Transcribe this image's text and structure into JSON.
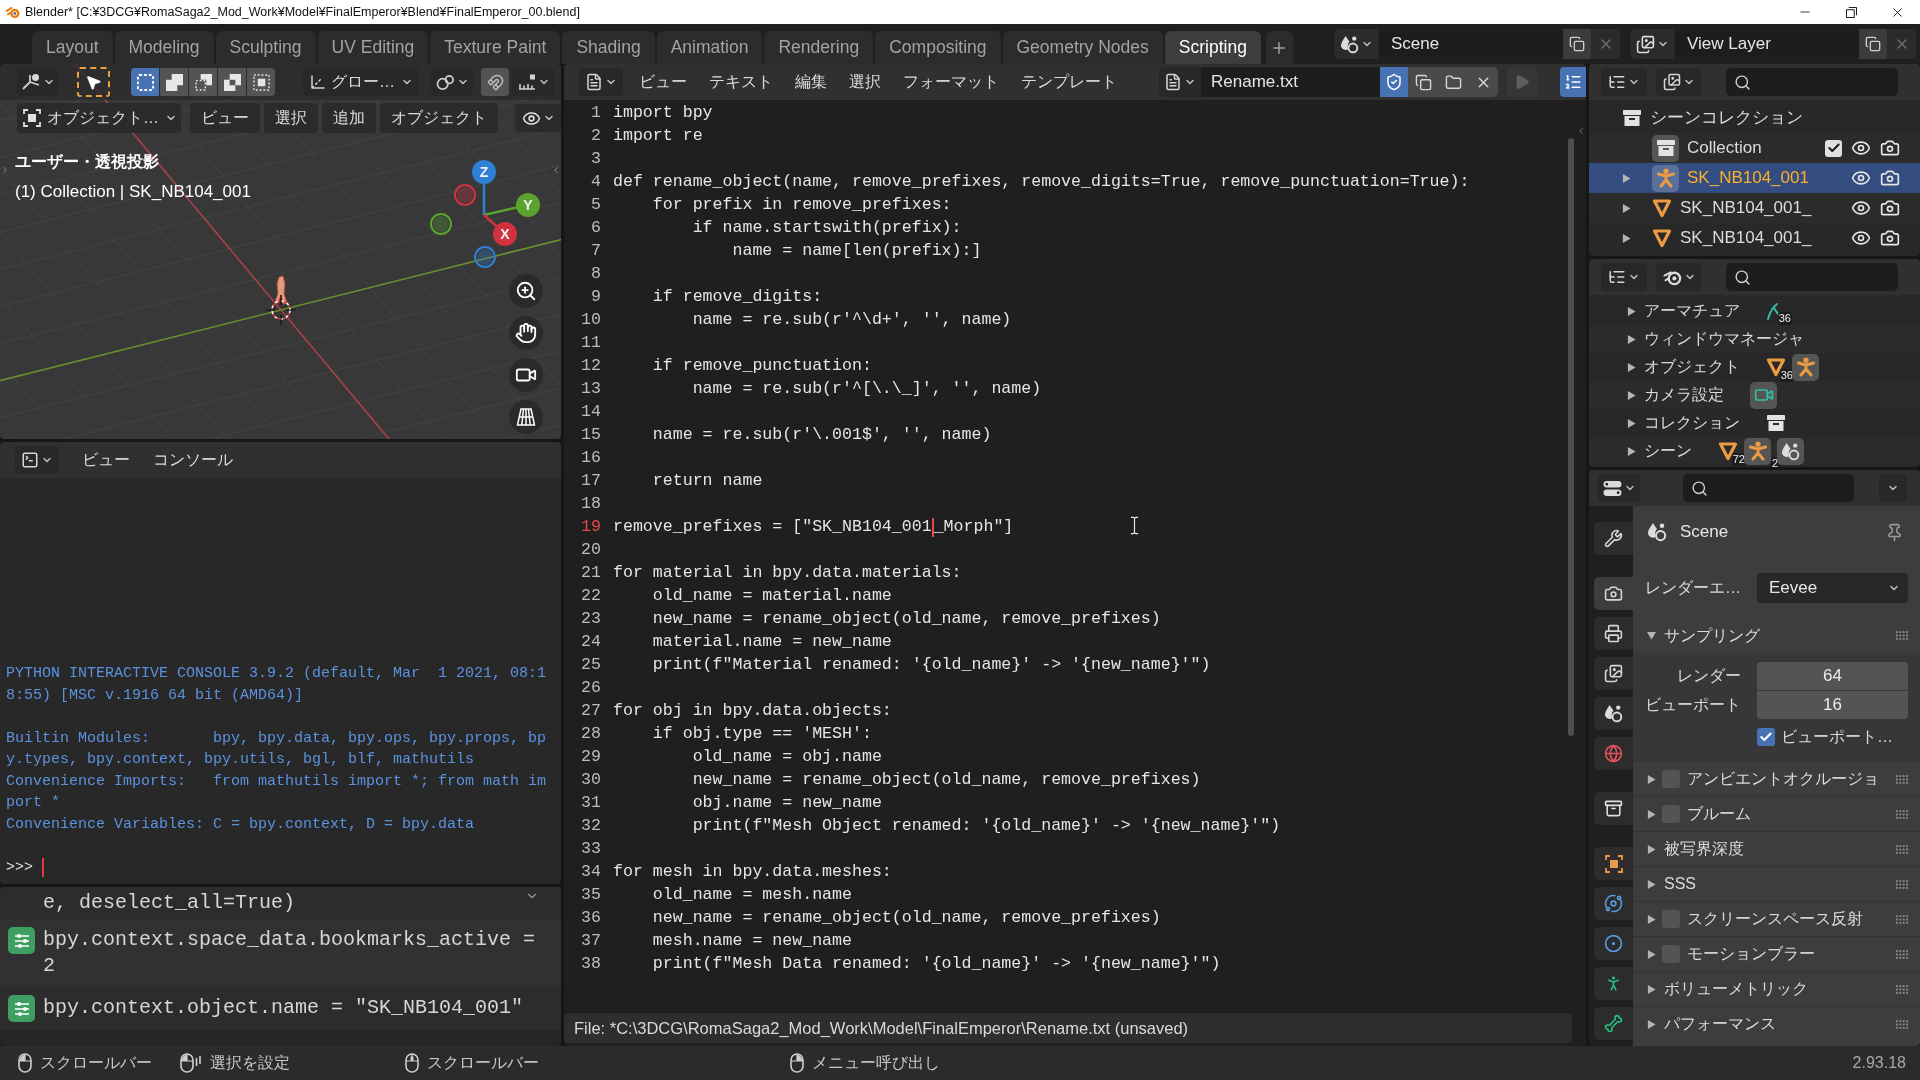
{
  "window": {
    "title": "Blender* [C:¥3DCG¥RomaSaga2_Mod_Work¥Model¥FinalEmperor¥Blend¥FinalEmperor_00.blend]"
  },
  "workspaces": [
    {
      "label": "Layout",
      "selected": false
    },
    {
      "label": "Modeling",
      "selected": false
    },
    {
      "label": "Sculpting",
      "selected": false
    },
    {
      "label": "UV Editing",
      "selected": false
    },
    {
      "label": "Texture Paint",
      "selected": false
    },
    {
      "label": "Shading",
      "selected": false
    },
    {
      "label": "Animation",
      "selected": false
    },
    {
      "label": "Rendering",
      "selected": false
    },
    {
      "label": "Compositing",
      "selected": false
    },
    {
      "label": "Geometry Nodes",
      "selected": false
    },
    {
      "label": "Scripting",
      "selected": true
    }
  ],
  "scene": "Scene",
  "view_layer": "View Layer",
  "viewport": {
    "selection_modes": [
      {
        "kind": "set",
        "selected": true
      },
      {
        "kind": "extend",
        "selected": false
      },
      {
        "kind": "subtract",
        "selected": false
      },
      {
        "kind": "invert",
        "selected": false
      },
      {
        "kind": "intersect",
        "selected": false
      }
    ],
    "orientation": "グロー…",
    "mode": "オブジェクト…",
    "menus": [
      "ビュー",
      "選択",
      "追加",
      "オブジェクト"
    ],
    "view_name": "ユーザー・透視投影",
    "context": "(1) Collection | SK_NB104_001",
    "gizmo": [
      {
        "kind": "positive",
        "label": "Z",
        "color": "#2f7fd6"
      },
      {
        "kind": "positive",
        "label": "Y",
        "color": "#5aa32f"
      },
      {
        "kind": "positive",
        "label": "X",
        "color": "#d2323f"
      },
      {
        "kind": "negative",
        "color": "#d2323f"
      },
      {
        "kind": "negative",
        "color": "#5aa32f"
      },
      {
        "kind": "negative",
        "color": "#2f7fd6"
      }
    ]
  },
  "console": {
    "menus": [
      "ビュー",
      "コンソール"
    ],
    "output": [
      [
        [
          "PYTHON INTERACTIVE CONSOLE 3.9.2 (default, Mar  1 2021, 08:1",
          "8:55) [MSC v.1916 64 bit (AMD64)]"
        ]
      ],
      [
        [
          "Builtin Modules:       bpy, bpy.data, bpy.ops, bpy.props, bp",
          "y.types, bpy.context, bpy.utils, bgl, blf, mathutils"
        ],
        [
          "Convenience Imports:   from mathutils import *; from math im",
          "port *"
        ],
        [
          "Convenience Variables: C = bpy.context, D = bpy.data"
        ]
      ]
    ],
    "prompt": ">>>"
  },
  "info_log": [
    {
      "kind": "continuation",
      "rows": [
        "e, deselect_all=True)"
      ]
    },
    {
      "kind": "operator",
      "rows": [
        "bpy.context.space_data.bookmarks_active =",
        "2"
      ]
    },
    {
      "kind": "operator",
      "rows": [
        "bpy.context.object.name = \"SK_NB104_001\""
      ]
    }
  ],
  "text_editor": {
    "menus": [
      "ビュー",
      "テキスト",
      "編集",
      "選択",
      "フォーマット",
      "テンプレート"
    ],
    "file_name": "Rename.txt",
    "fake_user": true,
    "run_disabled": true,
    "line_numbers": true,
    "lines": [
      {
        "number": "1",
        "text": "import bpy",
        "current": false
      },
      {
        "number": "2",
        "text": "import re",
        "current": false
      },
      {
        "number": "3",
        "current": false
      },
      {
        "number": "4",
        "text": "def rename_object(name, remove_prefixes, remove_digits=True, remove_punctuation=True):",
        "current": false
      },
      {
        "number": "5",
        "text": "    for prefix in remove_prefixes:",
        "current": false
      },
      {
        "number": "6",
        "text": "        if name.startswith(prefix):",
        "current": false
      },
      {
        "number": "7",
        "text": "            name = name[len(prefix):]",
        "current": false
      },
      {
        "number": "8",
        "current": false
      },
      {
        "number": "9",
        "text": "    if remove_digits:",
        "current": false
      },
      {
        "number": "10",
        "text": "        name = re.sub(r'^\\d+', '', name)",
        "current": false
      },
      {
        "number": "11",
        "current": false
      },
      {
        "number": "12",
        "text": "    if remove_punctuation:",
        "current": false
      },
      {
        "number": "13",
        "text": "        name = re.sub(r'^[\\.\\_]', '', name)",
        "current": false
      },
      {
        "number": "14",
        "current": false
      },
      {
        "number": "15",
        "text": "    name = re.sub(r'\\.001$', '', name)",
        "current": false
      },
      {
        "number": "16",
        "current": false
      },
      {
        "number": "17",
        "text": "    return name",
        "current": false
      },
      {
        "number": "18",
        "current": false
      },
      {
        "number": "19",
        "text": [
          "remove_prefixes = [\"SK_NB104_001",
          "_Morph\"]"
        ],
        "current": true
      },
      {
        "number": "20",
        "current": false
      },
      {
        "number": "21",
        "text": "for material in bpy.data.materials:",
        "current": false
      },
      {
        "number": "22",
        "text": "    old_name = material.name",
        "current": false
      },
      {
        "number": "23",
        "text": "    new_name = rename_object(old_name, remove_prefixes)",
        "current": false
      },
      {
        "number": "24",
        "text": "    material.name = new_name",
        "current": false
      },
      {
        "number": "25",
        "text": "    print(f\"Material renamed: '{old_name}' -> '{new_name}'\")",
        "current": false
      },
      {
        "number": "26",
        "current": false
      },
      {
        "number": "27",
        "text": "for obj in bpy.data.objects:",
        "current": false
      },
      {
        "number": "28",
        "text": "    if obj.type == 'MESH':",
        "current": false
      },
      {
        "number": "29",
        "text": "        old_name = obj.name",
        "current": false
      },
      {
        "number": "30",
        "text": "        new_name = rename_object(old_name, remove_prefixes)",
        "current": false
      },
      {
        "number": "31",
        "text": "        obj.name = new_name",
        "current": false
      },
      {
        "number": "32",
        "text": "        print(f\"Mesh Object renamed: '{old_name}' -> '{new_name}'\")",
        "current": false
      },
      {
        "number": "33",
        "current": false
      },
      {
        "number": "34",
        "text": "for mesh in bpy.data.meshes:",
        "current": false
      },
      {
        "number": "35",
        "text": "    old_name = mesh.name",
        "current": false
      },
      {
        "number": "36",
        "text": "    new_name = rename_object(old_name, remove_prefixes)",
        "current": false
      },
      {
        "number": "37",
        "text": "    mesh.name = new_name",
        "current": false
      },
      {
        "number": "38",
        "text": "    print(f\"Mesh Data renamed: '{old_name}' -> '{new_name}'\")",
        "current": false
      }
    ],
    "footer": "File: *C:\\3DCG\\RomaSaga2_Mod_Work\\Model\\FinalEmperor\\Rename.txt (unsaved)"
  },
  "outliner": {
    "tree": [
      {
        "label": "シーンコレクション",
        "kind": "scene_collection",
        "selected": false,
        "children": [
          {
            "label": "Collection",
            "kind": "collection",
            "selected": false,
            "active": true,
            "checked": true,
            "children": [
              {
                "label": "SK_NB104_001",
                "kind": "armature",
                "selected": true,
                "active": true,
                "expanded": false
              },
              {
                "label": "SK_NB104_001_",
                "kind": "mesh",
                "selected": false,
                "active": false,
                "expanded": false
              },
              {
                "label": "SK_NB104_001_",
                "kind": "mesh",
                "selected": false,
                "active": false,
                "expanded": false
              }
            ]
          }
        ]
      }
    ]
  },
  "blend_file": {
    "rows": [
      {
        "label": "アーマチュア",
        "expanded": false,
        "icons": [
          {
            "kind": "armature_data",
            "count": "36"
          }
        ]
      },
      {
        "label": "ウィンドウマネージャ",
        "expanded": false
      },
      {
        "label": "オブジェクト",
        "expanded": false,
        "icons": [
          {
            "kind": "mesh",
            "count": "36"
          },
          {
            "kind": "armature"
          }
        ]
      },
      {
        "label": "カメラ設定",
        "expanded": false,
        "icons": [
          {
            "kind": "camera"
          }
        ]
      },
      {
        "label": "コレクション",
        "expanded": false,
        "icons": [
          {
            "kind": "collection"
          }
        ]
      },
      {
        "label": "シーン",
        "expanded": false,
        "icons": [
          {
            "kind": "mesh",
            "count": "72"
          },
          {
            "kind": "armature",
            "count": "2"
          },
          {
            "kind": "scene"
          }
        ]
      }
    ]
  },
  "properties": {
    "tabs": [
      {
        "kind": "tool",
        "selected": false
      },
      {
        "kind": "render",
        "selected": true
      },
      {
        "kind": "output",
        "selected": false
      },
      {
        "kind": "view_layer",
        "selected": false
      },
      {
        "kind": "scene",
        "selected": false
      },
      {
        "kind": "world",
        "selected": false
      },
      {
        "kind": "collection",
        "selected": false
      },
      {
        "kind": "object",
        "selected": false
      },
      {
        "kind": "physics",
        "selected": false
      },
      {
        "kind": "constraints",
        "selected": false
      },
      {
        "kind": "data",
        "selected": false
      },
      {
        "kind": "bone",
        "selected": false
      }
    ],
    "context": "Scene",
    "engine": {
      "label": "レンダーエ…",
      "value": "Eevee"
    },
    "panels": [
      {
        "label": "サンプリング",
        "expanded": true,
        "fields": [
          {
            "label": "レンダー",
            "value": "64"
          },
          {
            "label": "ビューポート",
            "value": "16"
          }
        ],
        "options": [
          {
            "label": "ビューポート…",
            "checked": true
          }
        ]
      },
      {
        "label": "アンビエントオクルージョ",
        "expanded": false,
        "checked": false
      },
      {
        "label": "ブルーム",
        "expanded": false,
        "checked": false
      },
      {
        "label": "被写界深度",
        "expanded": false
      },
      {
        "label": "SSS",
        "expanded": false
      },
      {
        "label": "スクリーンスペース反射",
        "expanded": false,
        "checked": false
      },
      {
        "label": "モーションブラー",
        "expanded": false,
        "checked": false
      },
      {
        "label": "ボリューメトリック",
        "expanded": false
      },
      {
        "label": "パフォーマンス",
        "expanded": false
      }
    ]
  },
  "status_bar": {
    "hints": [
      {
        "kind": "left_click",
        "label": "スクロールバー"
      },
      {
        "kind": "left_drag",
        "label": "選択を設定"
      },
      {
        "kind": "middle_click",
        "label": "スクロールバー"
      },
      {
        "kind": "right_click",
        "label": "メニュー呼び出し"
      }
    ],
    "version": "2.93.18"
  }
}
